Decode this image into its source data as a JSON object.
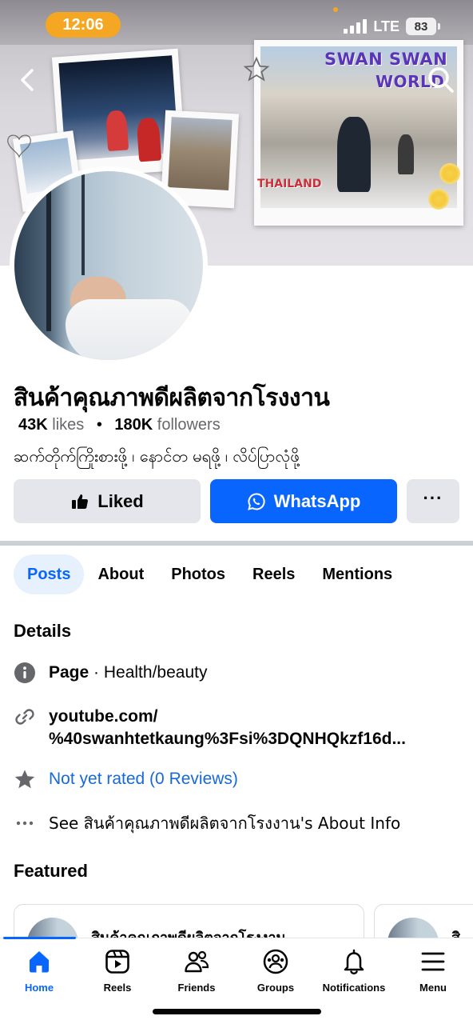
{
  "status_bar": {
    "time": "12:06",
    "network": "LTE",
    "battery": "83"
  },
  "cover": {
    "title_line1": "SWAN SWAN",
    "title_line2": "WORLD",
    "location_label": "THAILAND"
  },
  "page": {
    "name": "สินค้าคุณภาพดีผลิตจากโรงงาน",
    "likes_count": "43K",
    "likes_label": "likes",
    "followers_count": "180K",
    "followers_label": "followers",
    "bio": "ဆက်တိုက်ကြိုးစားဖို့ ၊ နောင်တ မရဖို့ ၊ လိပ်ပြာလုံဖို့"
  },
  "actions": {
    "liked_label": "Liked",
    "whatsapp_label": "WhatsApp",
    "more_label": "···"
  },
  "tabs": [
    {
      "label": "Posts",
      "active": true
    },
    {
      "label": "About",
      "active": false
    },
    {
      "label": "Photos",
      "active": false
    },
    {
      "label": "Reels",
      "active": false
    },
    {
      "label": "Mentions",
      "active": false
    }
  ],
  "details": {
    "title": "Details",
    "page_label": "Page",
    "page_category": " · Health/beauty",
    "link_line1": "youtube.com/",
    "link_line2": "%40swanhtetkaung%3Fsi%3DQNHQkzf16d...",
    "rating": "Not yet rated (0 Reviews)",
    "see_about": "See สินค้าคุณภาพดีผลิตจากโรงงาน's About Info"
  },
  "featured": {
    "title": "Featured",
    "card1_name": "สินค้าคุณภาพดีผลิตจากโรงงาน",
    "card2_name": "สิ"
  },
  "bottom_nav": [
    {
      "label": "Home",
      "icon": "home-icon",
      "active": true
    },
    {
      "label": "Reels",
      "icon": "reels-icon",
      "active": false
    },
    {
      "label": "Friends",
      "icon": "friends-icon",
      "active": false
    },
    {
      "label": "Groups",
      "icon": "groups-icon",
      "active": false
    },
    {
      "label": "Notifications",
      "icon": "bell-icon",
      "active": false
    },
    {
      "label": "Menu",
      "icon": "menu-icon",
      "active": false
    }
  ],
  "colors": {
    "accent": "#0866ff",
    "status_time_bg": "#f5a623",
    "link_blue": "#1769d8",
    "button_gray": "#e4e6eb"
  }
}
